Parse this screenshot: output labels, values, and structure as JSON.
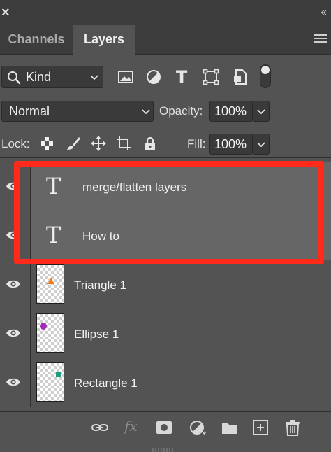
{
  "panel": {
    "close_glyph": "×",
    "collapse_glyph": "‹‹",
    "tabs": [
      {
        "label": "Channels",
        "active": false
      },
      {
        "label": "Layers",
        "active": true
      }
    ]
  },
  "filter": {
    "kind_label": "Kind",
    "icons": [
      "image-filter-icon",
      "adjustment-filter-icon",
      "type-filter-icon",
      "shape-filter-icon",
      "smart-object-filter-icon"
    ],
    "type_glyph": "T"
  },
  "blend": {
    "mode": "Normal",
    "opacity_label": "Opacity:",
    "opacity_value": "100%"
  },
  "lock": {
    "label": "Lock:",
    "fill_label": "Fill:",
    "fill_value": "100%"
  },
  "layers": [
    {
      "name": "merge/flatten layers",
      "type": "text",
      "visible": true
    },
    {
      "name": "How to",
      "type": "text",
      "visible": true
    },
    {
      "name": "Triangle 1",
      "type": "shape",
      "visible": true,
      "shape_color": "#f07a1e"
    },
    {
      "name": "Ellipse 1",
      "type": "shape",
      "visible": true,
      "shape_color": "#a12bb8"
    },
    {
      "name": "Rectangle 1",
      "type": "shape",
      "visible": true,
      "shape_color": "#1f9a83"
    }
  ],
  "text_layer_glyph": "T",
  "bottom_bar": {
    "fx_label": "fx",
    "icons": [
      "link-layers-icon",
      "fx-icon",
      "add-mask-icon",
      "adjustment-layer-icon",
      "new-group-icon",
      "new-layer-icon",
      "delete-layer-icon"
    ]
  },
  "colors": {
    "highlight": "#ff2a1a",
    "panel_bg": "#535353",
    "selected_layer_bg": "#666666"
  }
}
